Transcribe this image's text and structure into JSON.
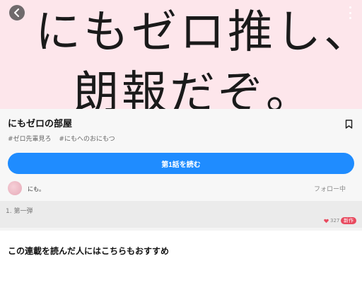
{
  "hero": {
    "line1": "にもゼロ推し、",
    "line2": "朗報だぞ。"
  },
  "series": {
    "title": "にもゼロの部屋",
    "tags": [
      "#ゼロ先輩見ろ",
      "#にもへのおにもつ"
    ],
    "read_button_label": "第1話を読む"
  },
  "author": {
    "name": "にも。",
    "follow_label": "フォロー中"
  },
  "episode": {
    "title": "1. 第一弾",
    "likes": "327",
    "badge": "新作"
  },
  "recommend": {
    "heading": "この連載を読んだ人にはこちらもおすすめ"
  },
  "icons": {
    "back": "chevron-left-icon",
    "more": "more-vertical-icon",
    "bookmark": "bookmark-icon",
    "heart": "heart-icon"
  },
  "colors": {
    "accent": "#1f8cff",
    "badge": "#e84a5f",
    "hero_bg": "#fde6eb"
  }
}
